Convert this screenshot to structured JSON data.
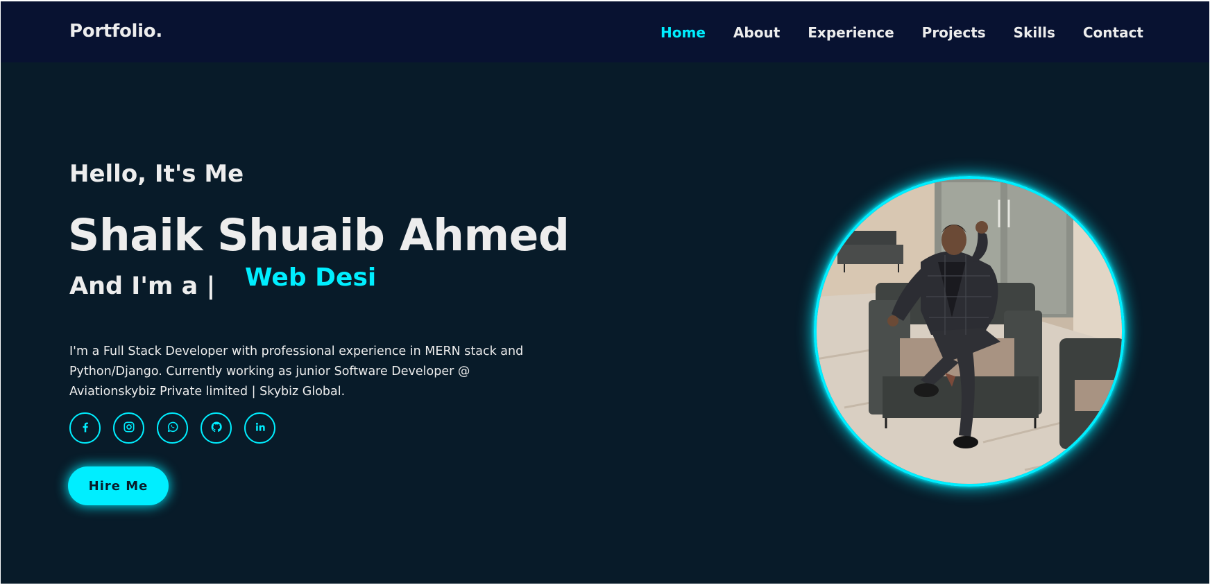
{
  "navbar": {
    "logo": "Portfolio.",
    "links": [
      {
        "label": "Home",
        "active": true
      },
      {
        "label": "About"
      },
      {
        "label": "Experience"
      },
      {
        "label": "Projects"
      },
      {
        "label": "Skills"
      },
      {
        "label": "Contact"
      }
    ]
  },
  "hero": {
    "greeting": "Hello, It's Me",
    "name": "Shaik Shuaib Ahmed",
    "role_prefix": "And I'm a |",
    "role_typed": "Web Desi",
    "bio": "I'm a Full Stack Developer with professional experience in MERN stack and Python/Django. Currently working as junior Software Developer @ Aviationskybiz Private limited | Skybiz Global.",
    "socials": [
      {
        "icon": "facebook-icon"
      },
      {
        "icon": "instagram-icon"
      },
      {
        "icon": "whatsapp-icon"
      },
      {
        "icon": "github-icon"
      },
      {
        "icon": "linkedin-icon"
      }
    ],
    "cta_label": "Hire Me"
  },
  "profile_photo": {
    "icon": "profile-photo"
  },
  "colors": {
    "accent": "#00eeff",
    "background": "#081b29",
    "navbar": "#081231",
    "text": "#ededed"
  }
}
